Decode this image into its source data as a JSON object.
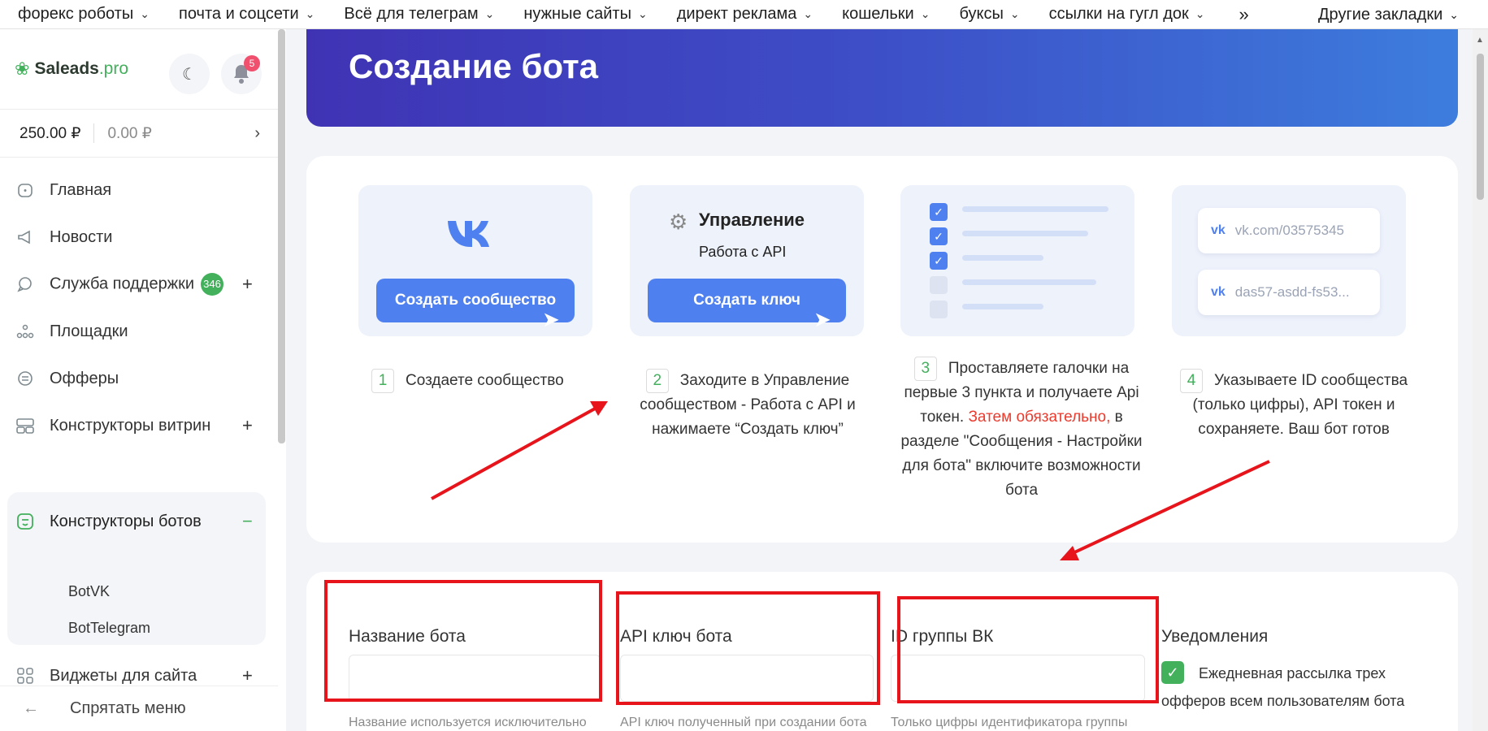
{
  "bookmarks": {
    "items": [
      "форекс роботы",
      "почта и соцсети",
      "Всё для телеграм",
      "нужные сайты",
      "директ реклама",
      "кошельки",
      "буксы",
      "ссылки на гугл док"
    ],
    "more": "»",
    "other": "Другие закладки"
  },
  "sidebar": {
    "logo_name": "Saleads",
    "logo_suffix": ".pro",
    "notifications_count": "5",
    "balance_main": "250.00 ₽",
    "balance_secondary": "0.00 ₽",
    "nav": [
      {
        "label": "Главная",
        "icon": "home-icon"
      },
      {
        "label": "Новости",
        "icon": "megaphone-icon"
      },
      {
        "label": "Служба поддержки",
        "icon": "chat-icon",
        "badge": "346",
        "plus": "+"
      },
      {
        "label": "Площадки",
        "icon": "nodes-icon"
      },
      {
        "label": "Офферы",
        "icon": "offer-icon"
      },
      {
        "label": "Конструкторы витрин",
        "icon": "showcase-icon",
        "plus": "+"
      },
      {
        "label": "Конструкторы ботов",
        "icon": "bot-icon",
        "minus": "−"
      },
      {
        "label": "Виджеты для сайта",
        "icon": "widgets-icon",
        "plus": "+"
      }
    ],
    "sub": [
      "BotVK",
      "BotTelegram"
    ],
    "hide_menu": "Спрятать меню",
    "accent": "#43b05c"
  },
  "hero": {
    "title": "Создание бота"
  },
  "steps": [
    {
      "num": "1",
      "text": "Создаете сообщество",
      "button": "Создать сообщество"
    },
    {
      "num": "2",
      "text": "Заходите в Управление сообществом - Работа с API и нажимаете “Создать ключ”",
      "button": "Создать ключ",
      "heading": "Управление",
      "sub": "Работа с API"
    },
    {
      "num": "3",
      "text_a": "Проставляете галочки на первые 3 пункта и получаете Api токен. ",
      "text_red": "Затем обязательно,",
      "text_b": " в разделе \"Сообщения - Настройки для бота\" включите возможности бота"
    },
    {
      "num": "4",
      "text": "Указываете ID сообщества (только цифры), API токен и сохраняете. Ваш бот готов",
      "chip1": "vk.com/03575345",
      "chip2": "das57-asdd-fs53..."
    }
  ],
  "form": {
    "fields": [
      {
        "label": "Название бота",
        "value": "",
        "hint": "Название используется исключительно"
      },
      {
        "label": "API ключ бота",
        "value": "",
        "hint": "API ключ полученный при создании бота"
      },
      {
        "label": "ID группы ВК",
        "value": "",
        "hint": "Только цифры идентификатора группы"
      }
    ],
    "notifications_label": "Уведомления",
    "notifications_option": "Ежедневная рассылка трех офферов всем пользователям бота",
    "notifications_checked": true
  },
  "colors": {
    "hero_start": "#3f33b4",
    "hero_end": "#3d7ddd",
    "button": "#4f80f0",
    "annotation": "#e8141c"
  }
}
